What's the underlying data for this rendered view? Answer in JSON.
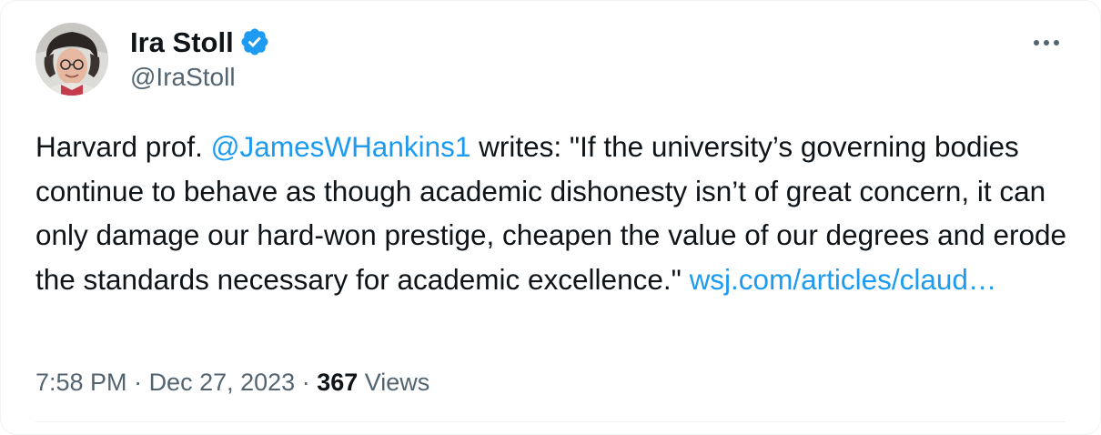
{
  "tweet": {
    "author": {
      "display_name": "Ira Stoll",
      "handle": "@IraStoll",
      "avatar_icon": "user-avatar-photo",
      "verified_icon": "verified-badge-icon"
    },
    "more_icon": "more-options-icon",
    "body": {
      "prefix": "Harvard prof. ",
      "mention": "@JamesWHankins1",
      "quote": " writes: \"If the university’s governing bodies continue to behave as though academic dishonesty isn’t of great concern, it can only damage our hard-won prestige, cheapen the value of our degrees and erode the standards necessary for academic excellence.\" ",
      "link": "wsj.com/articles/claud…"
    },
    "meta": {
      "time": "7:58 PM",
      "separator": " · ",
      "date": "Dec 27, 2023",
      "views_count": "367",
      "views_label": " Views"
    }
  },
  "colors": {
    "text": "#0f1419",
    "secondary": "#536471",
    "accent": "#1d9bf0",
    "divider": "#eff3f4"
  }
}
